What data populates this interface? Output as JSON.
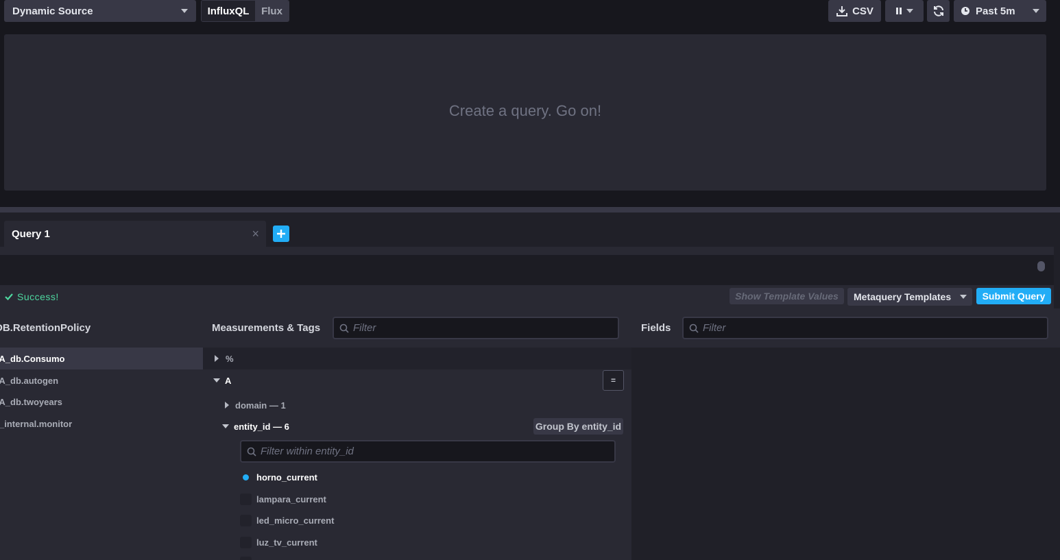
{
  "toolbar": {
    "source_label": "Dynamic Source",
    "lang_tabs": [
      "InfluxQL",
      "Flux"
    ],
    "csv_label": "CSV",
    "time_range_label": "Past 5m"
  },
  "graph": {
    "empty_message": "Create a query. Go on!"
  },
  "query_tabs": {
    "tab_label": "Query 1",
    "close_symbol": "×"
  },
  "editor": {
    "status": "Success!",
    "show_template_values": "Show Template Values",
    "metaquery_templates": "Metaquery Templates",
    "submit_query": "Submit Query"
  },
  "db_panel": {
    "header": "DB.RetentionPolicy",
    "items": [
      "HA_db.Consumo",
      "HA_db.autogen",
      "HA_db.twoyears",
      "_internal.monitor"
    ],
    "selected_index": 0
  },
  "measurements_panel": {
    "header": "Measurements & Tags",
    "filter_placeholder": "Filter",
    "items": [
      {
        "label": "%",
        "expanded": false
      },
      {
        "label": "A",
        "expanded": true
      }
    ],
    "eq_button": "=",
    "tags": [
      {
        "label": "domain — 1",
        "expanded": false
      },
      {
        "label": "entity_id — 6",
        "expanded": true
      }
    ],
    "group_by_label": "Group By entity_id",
    "tag_filter_placeholder": "Filter within entity_id",
    "tag_values": [
      {
        "label": "horno_current",
        "selected": true
      },
      {
        "label": "lampara_current",
        "selected": false
      },
      {
        "label": "led_micro_current",
        "selected": false
      },
      {
        "label": "luz_tv_current",
        "selected": false
      }
    ]
  },
  "fields_panel": {
    "header": "Fields",
    "filter_placeholder": "Filter"
  },
  "colors": {
    "accent_blue": "#22adf6",
    "success_green": "#4ed8a0",
    "panel_bg": "#292933"
  },
  "icons": [
    "caret-down-icon",
    "download-icon",
    "pause-icon",
    "refresh-icon",
    "clock-icon",
    "close-icon",
    "plus-icon",
    "check-icon",
    "search-icon",
    "caret-right-icon"
  ]
}
